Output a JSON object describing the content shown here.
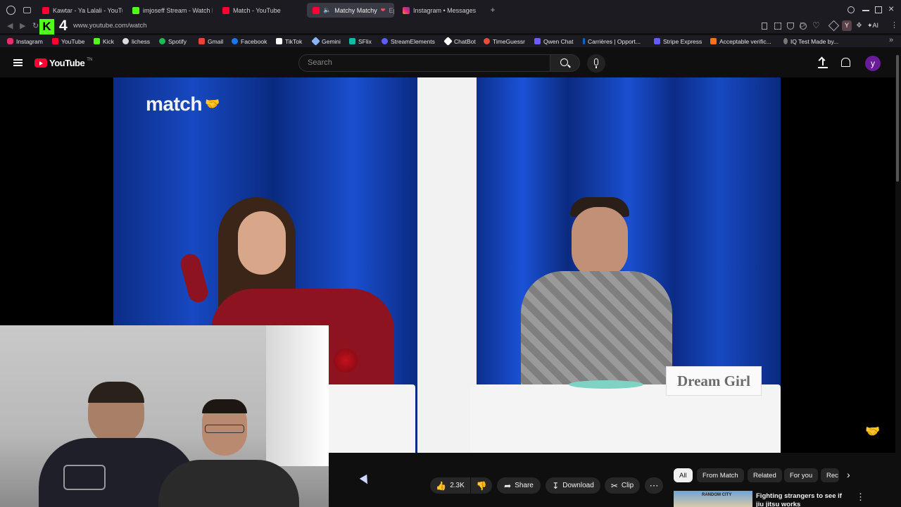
{
  "browser": {
    "tabs": [
      {
        "label": "Kawtar - Ya Lalali - YouTube",
        "color": "#ff0033"
      },
      {
        "label": "imjoseff Stream - Watch Live",
        "color": "#53fc18"
      },
      {
        "label": "Match - YouTube",
        "color": "#ff0033"
      },
      {
        "label": "Matchy Matchy",
        "color": "#ff0033",
        "suffix": "Ep"
      },
      {
        "label": "Instagram • Messages",
        "color": "#e1306c"
      }
    ],
    "url": "www.youtube.com/watch",
    "bookmarks": [
      {
        "label": "Instagram",
        "color": "#e1306c"
      },
      {
        "label": "YouTube",
        "color": "#ff0033"
      },
      {
        "label": "Kick",
        "color": "#53fc18"
      },
      {
        "label": "lichess",
        "color": "#dddddd"
      },
      {
        "label": "Spotify",
        "color": "#1db954"
      },
      {
        "label": "Gmail",
        "color": "#ea4335"
      },
      {
        "label": "Facebook",
        "color": "#1877f2"
      },
      {
        "label": "TikTok",
        "color": "#ffffff"
      },
      {
        "label": "Gemini",
        "color": "#8ab4f8"
      },
      {
        "label": "SFlix",
        "color": "#14b8a6"
      },
      {
        "label": "StreamElements",
        "color": "#5c5cff"
      },
      {
        "label": "ChatBot",
        "color": "#ffffff"
      },
      {
        "label": "TimeGuessr",
        "color": "#e74c3c"
      },
      {
        "label": "Qwen Chat",
        "color": "#6e5cf7"
      },
      {
        "label": "Carrières | Opport...",
        "color": "#0a66c2"
      },
      {
        "label": "Stripe Express",
        "color": "#635bff"
      },
      {
        "label": "Acceptable verific...",
        "color": "#f97316"
      },
      {
        "label": "IQ Test Made by...",
        "color": "#aaaaaa"
      }
    ],
    "toolbar_badge": "4",
    "ai_label": "AI"
  },
  "youtube": {
    "logo_text": "YouTube",
    "logo_region": "TN",
    "search_placeholder": "Search",
    "avatar_letter": "y",
    "brand_red": "#ff0033"
  },
  "video": {
    "channel_watermark": "match",
    "name_card": "Dream Girl"
  },
  "actions": {
    "likes": "2.3K",
    "share": "Share",
    "download": "Download",
    "clip": "Clip"
  },
  "chips": [
    "All",
    "From Match",
    "Related",
    "For you",
    "Rec"
  ],
  "recommendation": {
    "title": "Fighting strangers to see if jiu jitsu works",
    "thumb_text": "RANDOM CITY"
  }
}
